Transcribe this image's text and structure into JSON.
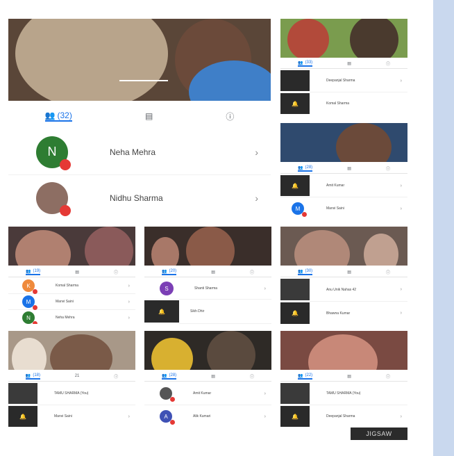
{
  "main_panel": {
    "tabs": {
      "participants_count": "(32)"
    },
    "participants": [
      {
        "initial": "N",
        "name": "Neha Mehra",
        "color": "#2e7d32"
      },
      {
        "initial": "",
        "name": "Nidhu Sharma",
        "color": "#8d6e63"
      }
    ]
  },
  "panels": {
    "top_right": {
      "count": "(33)",
      "rows": [
        "Deepanjal Sharma",
        "Komal Sharma"
      ]
    },
    "mid_right": {
      "count": "(28)",
      "rows": [
        {
          "initial": "",
          "name": "Amit Kumar"
        },
        {
          "initial": "M",
          "name": "Manvi Saini"
        }
      ]
    },
    "row3_left": {
      "count": "(19)",
      "rows": [
        {
          "initial": "K",
          "name": "Komal Sharma",
          "color": "#ef8a3c"
        },
        {
          "initial": "M",
          "name": "Manvi Saini",
          "color": "#1a73e8"
        },
        {
          "initial": "N",
          "name": "Neha Mehra",
          "color": "#2e7d32"
        }
      ]
    },
    "row3_mid": {
      "count": "(20)",
      "rows": [
        {
          "initial": "S",
          "name": "Shanti Sharma",
          "color": "#7b3fb5"
        },
        {
          "initial": "",
          "name": "Sikh Dhir"
        }
      ]
    },
    "row3_right": {
      "count": "(30)",
      "rows": [
        "Anu Unik Nahas 42",
        "Bhawna Kumar"
      ]
    },
    "row4_left": {
      "count": "(18)",
      "count2": "21",
      "rows": [
        "TAMU SHARMA (You)",
        "Manvi Saini"
      ]
    },
    "row4_mid": {
      "count": "(28)",
      "rows": [
        {
          "initial": "",
          "name": "Amit Kumar"
        },
        {
          "initial": "A",
          "name": "Alik Kumari",
          "color": "#3f51b5"
        }
      ]
    },
    "row4_right": {
      "count": "(22)",
      "rows": [
        "TAMU SHARMA (You)",
        "Deepanjal Sharma"
      ]
    }
  },
  "watermark": "JIGSAW",
  "colors": {
    "accent": "#1a73e8",
    "mic_off": "#e53935",
    "sidebar": "#c9d8ee"
  }
}
